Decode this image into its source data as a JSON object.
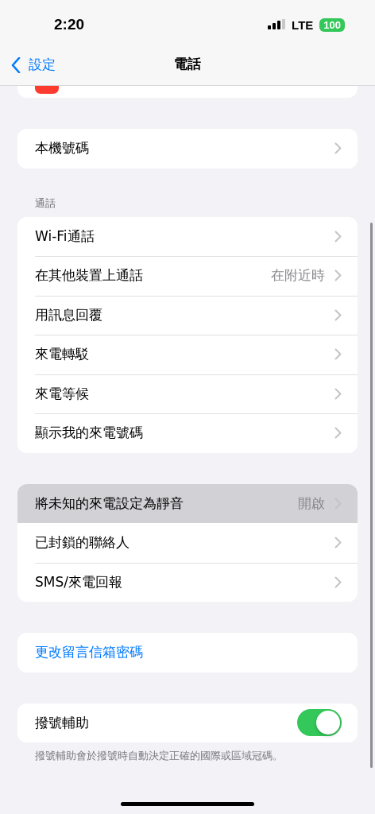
{
  "status_bar": {
    "time": "2:20",
    "network": "LTE",
    "battery": "100"
  },
  "nav": {
    "back": "設定",
    "title": "電話"
  },
  "sections": [
    {
      "rows": [
        {
          "kind": "nav",
          "label": "本機號碼",
          "selected": false
        }
      ]
    },
    {
      "header": "通話",
      "rows": [
        {
          "kind": "nav",
          "label": "Wi-Fi通話",
          "selected": false
        },
        {
          "kind": "nav",
          "label": "在其他裝置上通話",
          "value": "在附近時",
          "selected": false
        },
        {
          "kind": "nav",
          "label": "用訊息回覆",
          "selected": false
        },
        {
          "kind": "nav",
          "label": "來電轉駁",
          "selected": false
        },
        {
          "kind": "nav",
          "label": "來電等候",
          "selected": false
        },
        {
          "kind": "nav",
          "label": "顯示我的來電號碼",
          "selected": false
        }
      ]
    },
    {
      "rows": [
        {
          "kind": "nav",
          "label": "將未知的來電設定為靜音",
          "value": "開啟",
          "selected": true
        },
        {
          "kind": "nav",
          "label": "已封鎖的聯絡人",
          "selected": false
        },
        {
          "kind": "nav",
          "label": "SMS/來電回報",
          "selected": false
        }
      ]
    },
    {
      "rows": [
        {
          "kind": "link",
          "label": "更改留言信箱密碼",
          "selected": false
        }
      ]
    },
    {
      "rows": [
        {
          "kind": "toggle",
          "label": "撥號輔助",
          "on": true
        }
      ],
      "footer": "撥號輔助會於撥號時自動決定正確的國際或區域冠碼。"
    }
  ]
}
